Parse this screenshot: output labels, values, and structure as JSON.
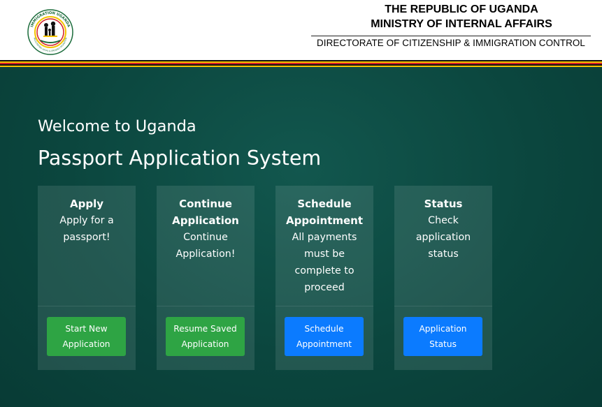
{
  "header": {
    "line1": "THE REPUBLIC OF UGANDA",
    "line2": "MINISTRY OF INTERNAL AFFAIRS",
    "line3": "DIRECTORATE OF CITIZENSHIP & IMMIGRATION CONTROL",
    "logo_top_text": "IMMIGRATION UGANDA",
    "logo_bottom_text": "FACILITATING LEGAL & ORDERLY MIGRATION"
  },
  "hero": {
    "welcome": "Welcome to Uganda",
    "system": "Passport Application System"
  },
  "cards": [
    {
      "title": "Apply",
      "text": "Apply for a passport!",
      "button": "Start New Application",
      "button_color": "#2ea444"
    },
    {
      "title": "Continue Application",
      "text": "Continue Application!",
      "button": "Resume Saved Application",
      "button_color": "#2ea444"
    },
    {
      "title": "Schedule Appointment",
      "text": "All payments must be complete to proceed",
      "button": "Schedule Appointment",
      "button_color": "#0b7bff"
    },
    {
      "title": "Status",
      "text": "Check application status",
      "button": "Application Status",
      "button_color": "#0b7bff"
    }
  ],
  "colors": {
    "background": "#0c4a42",
    "flag_black": "#111111",
    "flag_yellow": "#f4c400",
    "flag_red": "#d21f26"
  }
}
